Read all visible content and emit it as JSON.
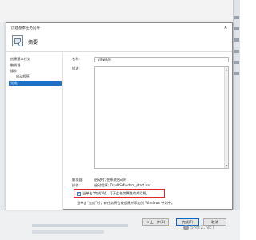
{
  "window": {
    "title": "创建基本任务向导",
    "close_glyph": "✕",
    "header_title": "摘要",
    "header_icon": "task-scheduler-icon"
  },
  "nav": {
    "items": [
      {
        "label": "创建基本任务",
        "active": false
      },
      {
        "label": "触发器",
        "active": false
      },
      {
        "label": "操作",
        "active": false
      },
      {
        "label": "启动程序",
        "active": false
      },
      {
        "label": "完成",
        "active": true
      }
    ]
  },
  "summary": {
    "name_label": "名称:",
    "name_value": "vmware",
    "description_label": "描述:",
    "trigger_label": "触发器:",
    "trigger_value": "启动时; 在系统启动时",
    "action_label": "操作:",
    "action_value": "启动程序; D:\\vDSM\\vdsm_start.bat"
  },
  "options": {
    "open_properties_label": "当单击“完成”时，打开此任务属性的对话框。",
    "open_properties_checked": true,
    "note": "当单击“完成”时，新任务将会被创建并添加到 Windows 计划中。"
  },
  "buttons": {
    "back": "< 上一步(B)",
    "finish": "完成(F)",
    "cancel": "取消"
  },
  "colors": {
    "accent": "#1f6fc2",
    "highlight_border": "#e0262b"
  },
  "watermark": {
    "text": "SMYZ.NET",
    "icon": "watermark-logo-icon"
  }
}
